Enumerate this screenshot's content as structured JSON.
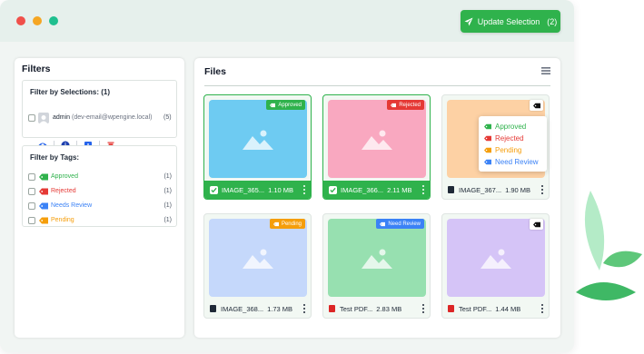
{
  "window": {
    "controls": [
      {
        "name": "close",
        "color": "#f0504a"
      },
      {
        "name": "minimize",
        "color": "#f5a623"
      },
      {
        "name": "maximize",
        "color": "#1fbf8f"
      }
    ]
  },
  "toolbar": {
    "update_label": "Update Selection",
    "update_count": "(2)",
    "icon": "send-icon"
  },
  "filters": {
    "title": "Filters",
    "selections": {
      "title": "Filter by Selections: (1)",
      "user": {
        "name": "admin",
        "email": "(dev-email@wpengine.local)",
        "count": "(5)"
      },
      "actions": [
        "eye-icon",
        "info-icon",
        "download-icon",
        "trash-icon"
      ]
    },
    "tags": {
      "title": "Filter by Tags:",
      "items": [
        {
          "label": "Approved",
          "count": "(1)",
          "color": "#2fb24c"
        },
        {
          "label": "Rejected",
          "count": "(1)",
          "color": "#e53935"
        },
        {
          "label": "Needs Review",
          "count": "(1)",
          "color": "#3b82f6"
        },
        {
          "label": "Pending",
          "count": "(1)",
          "color": "#f59e0b"
        }
      ]
    }
  },
  "files": {
    "title": "Files",
    "cards": [
      {
        "name": "IMAGE_365...",
        "size": "1.10 MB",
        "badge": "Approved",
        "badge_color": "#2fb24c",
        "thumb": "#6ecbf2",
        "selected": true
      },
      {
        "name": "IMAGE_366...",
        "size": "2.11 MB",
        "badge": "Rejected",
        "badge_color": "#e53935",
        "thumb": "#f9a8c0",
        "selected": true
      },
      {
        "name": "IMAGE_367...",
        "size": "1.90 MB",
        "badge": "",
        "badge_color": "",
        "thumb": "#fdd1a4",
        "selected": false
      },
      {
        "name": "IMAGE_368...",
        "size": "1.73 MB",
        "badge": "Pending",
        "badge_color": "#f59e0b",
        "thumb": "#c5d8fb",
        "selected": false
      },
      {
        "name": "Test PDF...",
        "size": "2.83 MB",
        "badge": "Need Review",
        "badge_color": "#3b82f6",
        "thumb": "#97e0b0",
        "selected": false
      },
      {
        "name": "Test PDF...",
        "size": "1.44 MB",
        "badge": "",
        "badge_color": "",
        "thumb": "#d5c4f7",
        "selected": false
      }
    ],
    "tag_dropdown": [
      {
        "label": "Approved",
        "color": "#2fb24c"
      },
      {
        "label": "Rejected",
        "color": "#e53935"
      },
      {
        "label": "Pending",
        "color": "#f59e0b"
      },
      {
        "label": "Need Review",
        "color": "#3b82f6"
      }
    ]
  }
}
